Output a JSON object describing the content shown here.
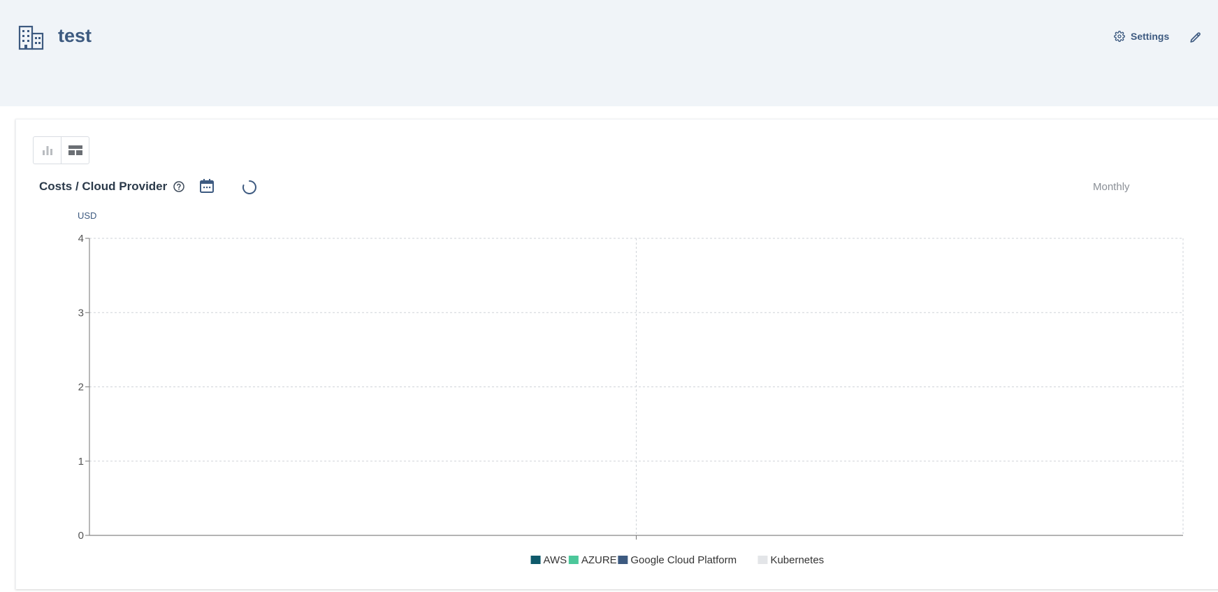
{
  "header": {
    "title": "test",
    "settings_label": "Settings",
    "icons": {
      "entity": "building-icon",
      "settings": "gear-icon",
      "edit": "pencil-icon"
    }
  },
  "toolbar": {
    "chart_view": "bar-chart-icon",
    "table_view": "table-icon"
  },
  "card": {
    "title": "Costs / Cloud Provider",
    "period": "Monthly",
    "icons": {
      "help": "help-circle-icon",
      "calendar": "calendar-icon",
      "loading": "loading-spinner-icon"
    }
  },
  "chart_data": {
    "type": "bar",
    "ylabel": "USD",
    "ylim": [
      0,
      4
    ],
    "y_ticks": [
      "0",
      "1",
      "2",
      "3",
      "4"
    ],
    "categories": [],
    "series": [
      {
        "name": "AWS",
        "values": [],
        "color": "#0f5a6b"
      },
      {
        "name": "AZURE",
        "values": [],
        "color": "#4cc79a"
      },
      {
        "name": "Google Cloud Platform",
        "values": [],
        "color": "#3d5a80"
      },
      {
        "name": "Kubernetes",
        "values": [],
        "color": "#e3e5e8"
      }
    ],
    "grid": true,
    "legend_position": "bottom"
  }
}
